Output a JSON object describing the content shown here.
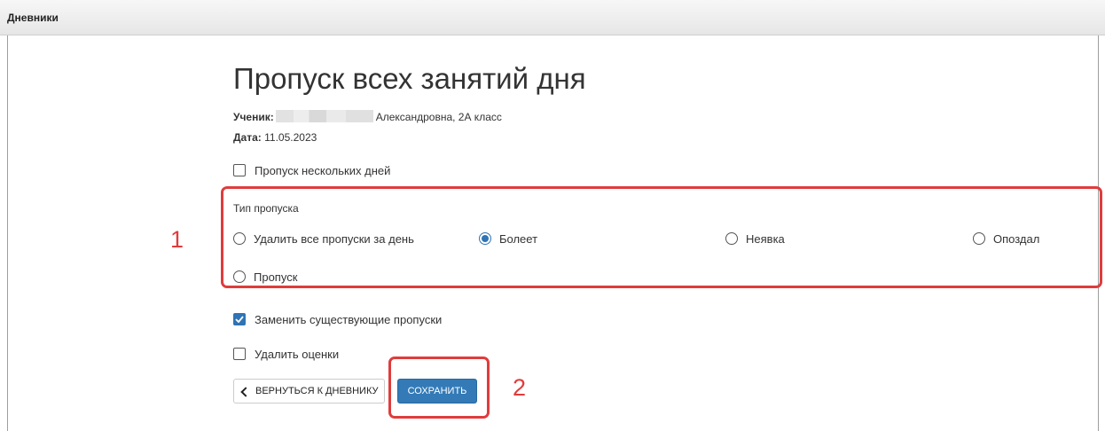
{
  "header": {
    "title": "Дневники"
  },
  "page": {
    "title": "Пропуск всех занятий дня",
    "student_label": "Ученик:",
    "student_value": "Александровна, 2А класс",
    "date_label": "Дата:",
    "date_value": "11.05.2023"
  },
  "options": {
    "multi_day": {
      "label": "Пропуск нескольких дней",
      "checked": false
    },
    "replace_existing": {
      "label": "Заменить существующие пропуски",
      "checked": true
    },
    "delete_marks": {
      "label": "Удалить оценки",
      "checked": false
    }
  },
  "absence_type": {
    "label": "Тип пропуска",
    "selected": "Болеет",
    "options": [
      "Удалить все пропуски за день",
      "Болеет",
      "Неявка",
      "Опоздал",
      "Пропуск"
    ]
  },
  "buttons": {
    "back": "ВЕРНУТЬСЯ К ДНЕВНИКУ",
    "save": "СОХРАНИТЬ"
  },
  "annotations": {
    "marker_1": "1",
    "marker_2": "2",
    "color": "#e03c3c"
  },
  "colors": {
    "accent": "#337ab7"
  }
}
